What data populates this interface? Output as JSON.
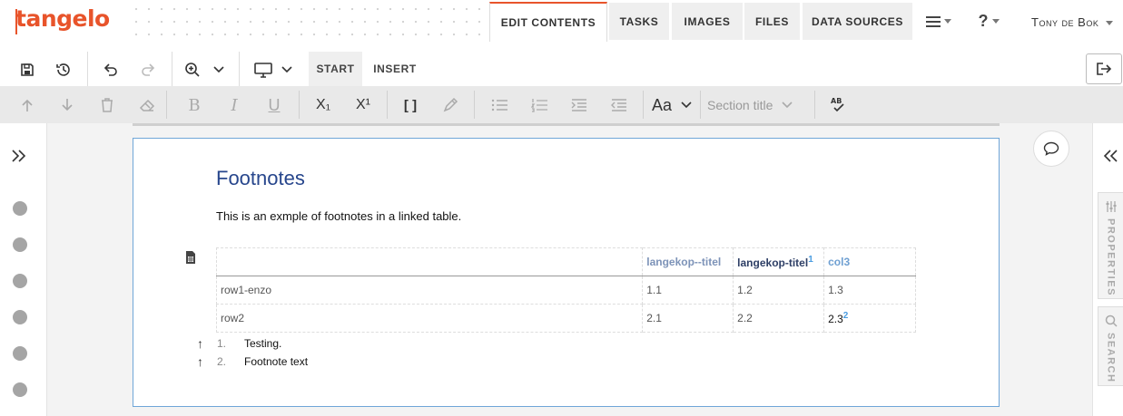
{
  "brand": {
    "logo_text": "tangelo",
    "color": "#e8542b"
  },
  "nav": {
    "tabs": [
      {
        "label": "EDIT CONTENTS",
        "active": true
      },
      {
        "label": "TASKS"
      },
      {
        "label": "IMAGES"
      },
      {
        "label": "FILES"
      },
      {
        "label": "DATA SOURCES"
      }
    ],
    "menu_icon": "hamburger-icon",
    "help_label": "?",
    "user_name": "Tony de Bok"
  },
  "toolbar": {
    "start_label": "START",
    "insert_label": "INSERT",
    "icons": [
      "save-icon",
      "history-icon",
      "undo-icon",
      "redo-icon",
      "zoom-in-icon",
      "monitor-icon",
      "exit-icon"
    ]
  },
  "format_bar": {
    "style_label": "Section title",
    "font_label": "Aa",
    "subscript_label": "X₁",
    "superscript_label": "X¹",
    "brackets_label": "[ ]",
    "bold_label": "B",
    "italic_label": "I",
    "underline_label": "U"
  },
  "document": {
    "heading": "Footnotes",
    "paragraph": "This is an exmple of footnotes in a linked table.",
    "table": {
      "headers": [
        {
          "label": ""
        },
        {
          "label": "langekop--titel"
        },
        {
          "label": "langekop-titel",
          "footnote": "1"
        },
        {
          "label": "col3"
        }
      ],
      "rows": [
        {
          "cells": [
            "row1-enzo",
            "1.1",
            "1.2",
            "1.3"
          ]
        },
        {
          "cells": [
            "row2",
            "2.1",
            "2.2",
            "2.3"
          ],
          "last_footnote": "2"
        }
      ]
    },
    "footnotes": [
      {
        "num": "1.",
        "text": "Testing."
      },
      {
        "num": "2.",
        "text": "Footnote text"
      }
    ]
  },
  "sidebar_right": {
    "properties_label": "PROPERTIES",
    "search_label": "SEARCH"
  }
}
